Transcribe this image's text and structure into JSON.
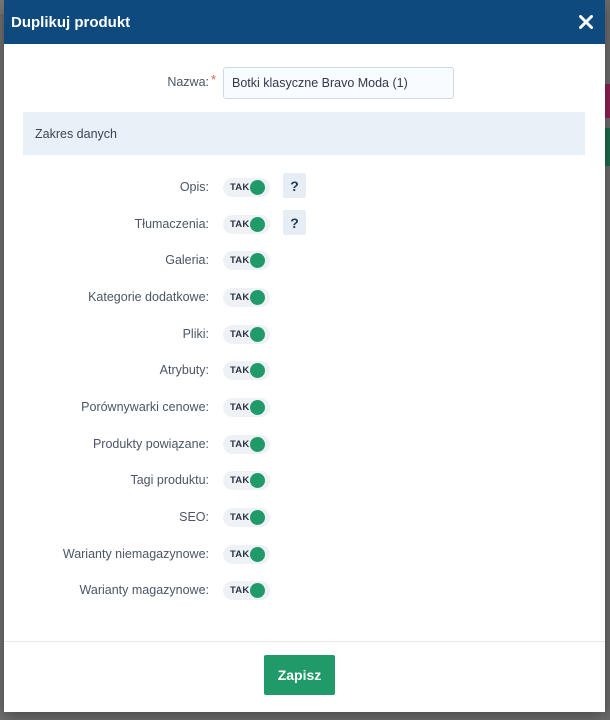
{
  "modal": {
    "title": "Duplikuj produkt",
    "header_color": "#0e4a7e",
    "close_icon": "close-icon"
  },
  "name_field": {
    "label": "Nazwa:",
    "required_mark": "*",
    "value": "Botki klasyczne Bravo Moda (1)"
  },
  "section": {
    "title": "Zakres danych"
  },
  "options": [
    {
      "label": "Opis:",
      "state": "TAK",
      "help": "?"
    },
    {
      "label": "Tłumaczenia:",
      "state": "TAK",
      "help": "?"
    },
    {
      "label": "Galeria:",
      "state": "TAK"
    },
    {
      "label": "Kategorie dodatkowe:",
      "state": "TAK"
    },
    {
      "label": "Pliki:",
      "state": "TAK"
    },
    {
      "label": "Atrybuty:",
      "state": "TAK"
    },
    {
      "label": "Porównywarki cenowe:",
      "state": "TAK"
    },
    {
      "label": "Produkty powiązane:",
      "state": "TAK"
    },
    {
      "label": "Tagi produktu:",
      "state": "TAK"
    },
    {
      "label": "SEO:",
      "state": "TAK"
    },
    {
      "label": "Warianty niemagazynowe:",
      "state": "TAK"
    },
    {
      "label": "Warianty magazynowe:",
      "state": "TAK"
    }
  ],
  "footer": {
    "save_label": "Zapisz",
    "save_color": "#1f9a68"
  }
}
